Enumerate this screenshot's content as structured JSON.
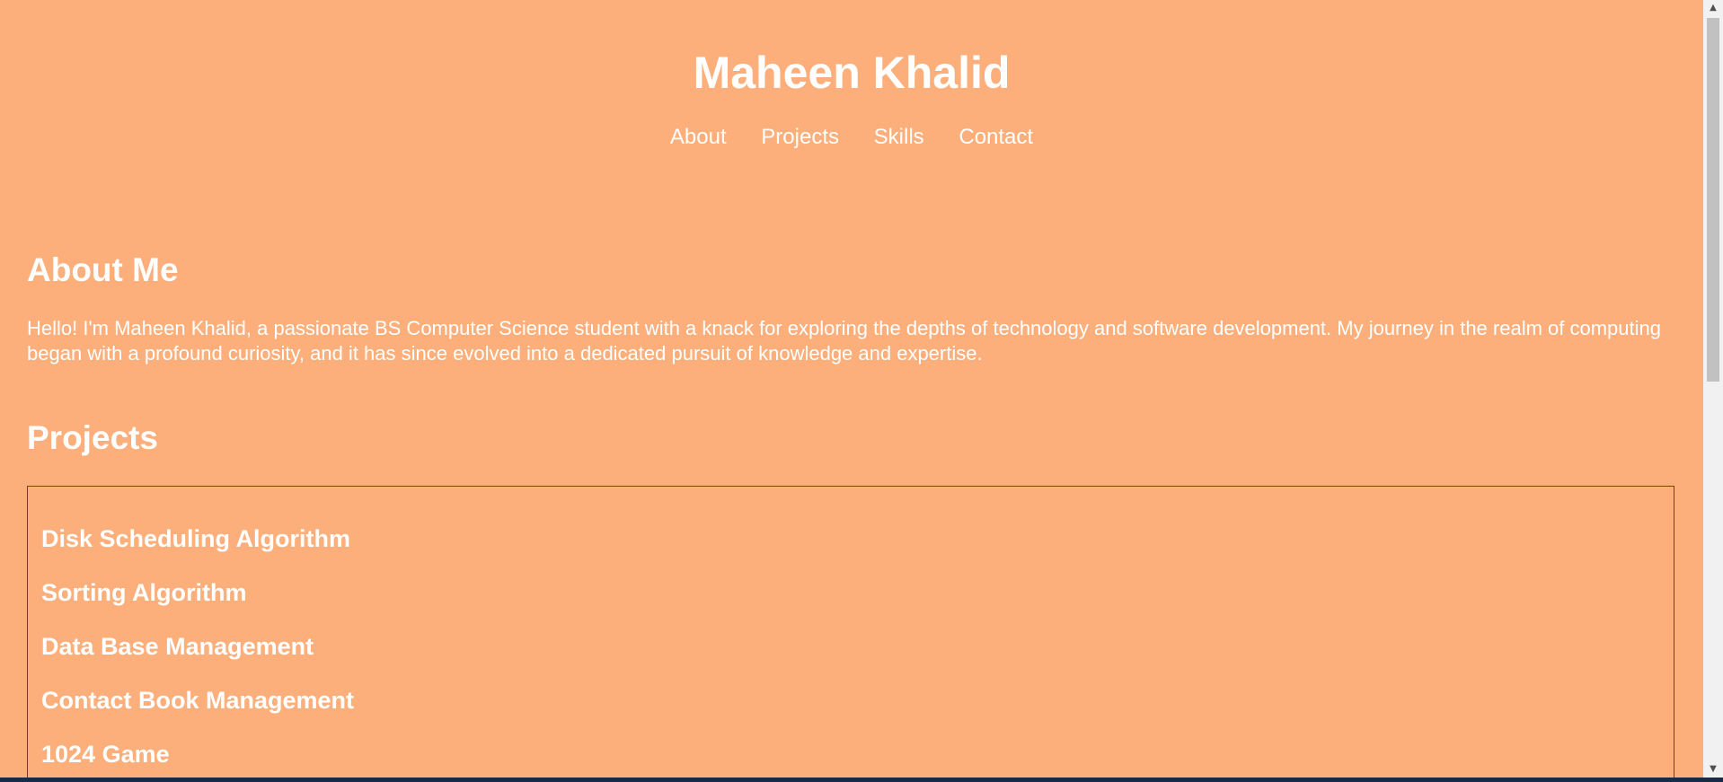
{
  "header": {
    "title": "Maheen Khalid",
    "nav": [
      {
        "label": "About"
      },
      {
        "label": "Projects"
      },
      {
        "label": "Skills"
      },
      {
        "label": "Contact"
      }
    ]
  },
  "about": {
    "title": "About Me",
    "text": "Hello! I'm Maheen Khalid, a passionate BS Computer Science student with a knack for exploring the depths of technology and software development. My journey in the realm of computing began with a profound curiosity, and it has since evolved into a dedicated pursuit of knowledge and expertise."
  },
  "projects": {
    "title": "Projects",
    "items": [
      {
        "label": "Disk Scheduling Algorithm"
      },
      {
        "label": "Sorting Algorithm"
      },
      {
        "label": "Data Base Management"
      },
      {
        "label": "Contact Book Management"
      },
      {
        "label": "1024 Game"
      }
    ]
  },
  "colors": {
    "page_background": "#fcaf7b",
    "text": "#ffffff",
    "project_border": "#7a3a2a"
  },
  "icons": {
    "scroll_up": "scroll-up-arrow-icon",
    "scroll_down": "scroll-down-arrow-icon"
  }
}
